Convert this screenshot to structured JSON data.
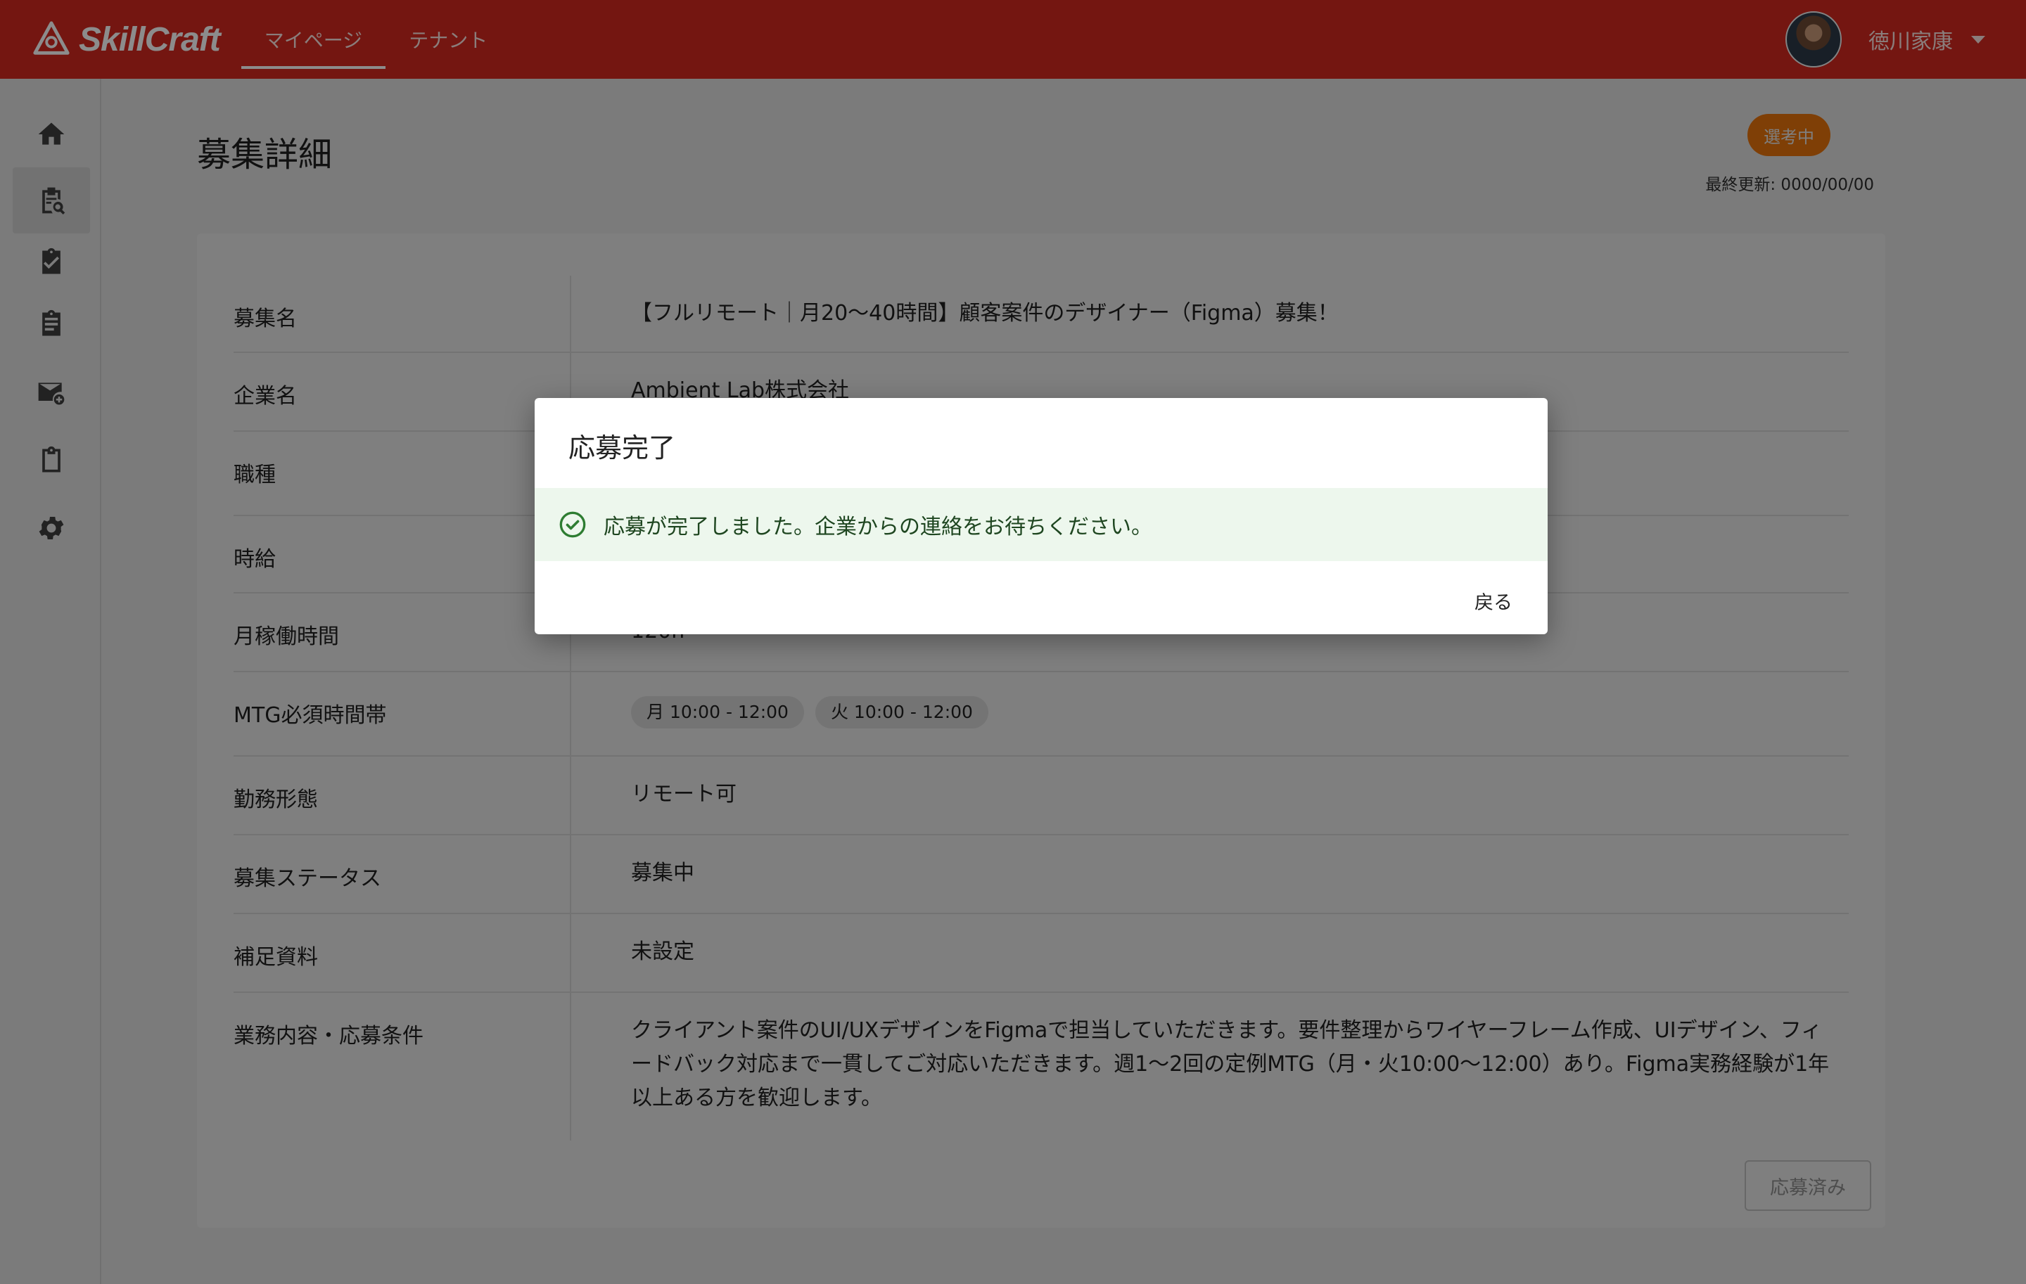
{
  "header": {
    "logo_text": "SkillCraft",
    "tabs": [
      {
        "label": "マイページ",
        "active": true
      },
      {
        "label": "テナント",
        "active": false
      }
    ],
    "user_name": "徳川家康"
  },
  "sidebar": {
    "items": [
      {
        "icon": "home-icon"
      },
      {
        "icon": "search-document-icon",
        "active": true
      },
      {
        "icon": "checkbox-icon"
      },
      {
        "icon": "assignment-icon"
      },
      {
        "icon": "mail-add-icon"
      },
      {
        "icon": "clipboard-icon"
      },
      {
        "icon": "gear-icon"
      }
    ]
  },
  "page": {
    "title": "募集詳細",
    "status_badge": "選考中",
    "status_color": "#ff7e0d",
    "last_updated": "最終更新: 0000/00/00"
  },
  "details": {
    "rows": [
      {
        "label": "募集名",
        "value": "【フルリモート｜月20〜40時間】顧客案件のデザイナー（Figma）募集！"
      },
      {
        "label": "企業名",
        "value": "Ambient Lab株式会社"
      },
      {
        "label": "職種",
        "value": ""
      },
      {
        "label": "時給",
        "value": ""
      },
      {
        "label": "月稼働時間",
        "value": "120h"
      },
      {
        "label": "MTG必須時間帯",
        "chips": [
          "月 10:00 - 12:00",
          "火 10:00 - 12:00"
        ]
      },
      {
        "label": "勤務形態",
        "value": "リモート可"
      },
      {
        "label": "募集ステータス",
        "value": "募集中"
      },
      {
        "label": "補足資料",
        "value": "未設定"
      },
      {
        "label": "業務内容・応募条件",
        "value": "クライアント案件のUI/UXデザインをFigmaで担当していただきます。要件整理からワイヤーフレーム作成、UIデザイン、フィードバック対応まで一貫してご対応いただきます。週1〜2回の定例MTG（月・火10:00〜12:00）あり。Figma実務経験が1年以上ある方を歓迎します。"
      }
    ],
    "applied_button": "応募済み"
  },
  "modal": {
    "title": "応募完了",
    "message": "応募が完了しました。企業からの連絡をお待ちください。",
    "back_button": "戻る",
    "success_color": "#2e7d32"
  }
}
